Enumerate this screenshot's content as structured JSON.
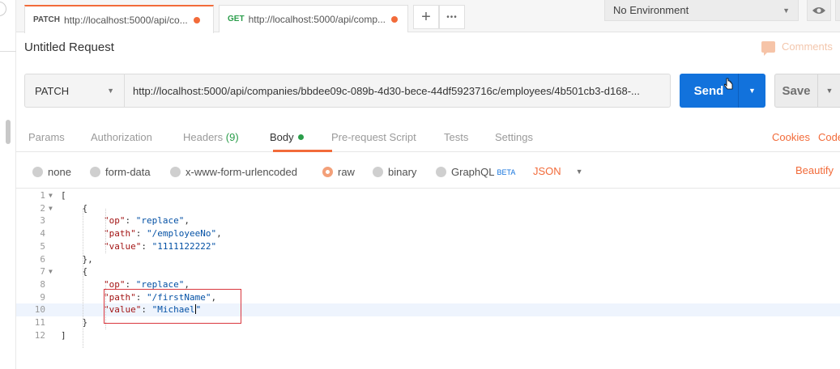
{
  "tabs": [
    {
      "method": "PATCH",
      "url": "http://localhost:5000/api/co...",
      "active": true
    },
    {
      "method": "GET",
      "url": "http://localhost:5000/api/comp...",
      "active": false
    }
  ],
  "tab_actions": {
    "new_tab": "+",
    "more": "•••"
  },
  "environment": {
    "selected": "No Environment"
  },
  "request": {
    "title": "Untitled Request",
    "comments_label": "Comments",
    "method": "PATCH",
    "url": "http://localhost:5000/api/companies/bbdee09c-089b-4d30-bece-44df5923716c/employees/4b501cb3-d168-...",
    "send_label": "Send",
    "save_label": "Save"
  },
  "request_tabs": {
    "params": "Params",
    "authorization": "Authorization",
    "headers": "Headers",
    "headers_count": "(9)",
    "body": "Body",
    "pre_request_script": "Pre-request Script",
    "tests": "Tests",
    "settings": "Settings",
    "cookies": "Cookies",
    "code": "Code"
  },
  "body_types": {
    "none": "none",
    "form_data": "form-data",
    "urlencoded": "x-www-form-urlencoded",
    "raw": "raw",
    "binary": "binary",
    "graphql": "GraphQL",
    "graphql_badge": "BETA",
    "selected": "raw",
    "format": "JSON",
    "beautify": "Beautify"
  },
  "editor": {
    "line_numbers": [
      "1",
      "2",
      "3",
      "4",
      "5",
      "6",
      "7",
      "8",
      "9",
      "10",
      "11",
      "12"
    ],
    "active_line": 10,
    "lines": [
      {
        "t": "["
      },
      {
        "t": "    {"
      },
      {
        "key": "\"op\"",
        "val": "\"replace\"",
        "end": ","
      },
      {
        "key": "\"path\"",
        "val": "\"/employeeNo\"",
        "end": ","
      },
      {
        "key": "\"value\"",
        "val": "\"1111122222\"",
        "end": ""
      },
      {
        "t": "    },"
      },
      {
        "t": "    {"
      },
      {
        "key": "\"op\"",
        "val": "\"replace\"",
        "end": ","
      },
      {
        "key": "\"path\"",
        "val": "\"/firstName\"",
        "end": ","
      },
      {
        "key": "\"value\"",
        "val": "\"Michael\"",
        "end": ""
      },
      {
        "t": "    }"
      },
      {
        "t": "]"
      }
    ]
  }
}
